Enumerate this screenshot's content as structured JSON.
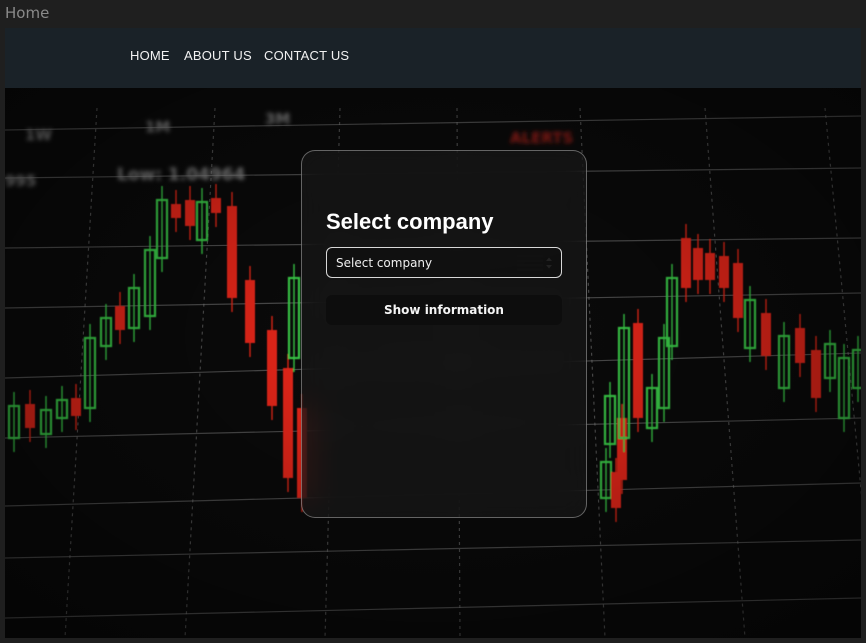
{
  "browser": {
    "tab_title": "Home"
  },
  "nav": {
    "items": [
      {
        "label": "HOME"
      },
      {
        "label": "ABOUT US"
      },
      {
        "label": "CONTACT US"
      }
    ]
  },
  "hero": {
    "background": "candlestick chart photo",
    "screen_labels": [
      "1W",
      "1M",
      "3M",
      "995",
      "Low: 1.04964",
      "ALERTS"
    ]
  },
  "card": {
    "title": "Select  company",
    "select": {
      "value": "Select company"
    },
    "button_label": "Show information"
  },
  "colors": {
    "navbar": "#1a2228",
    "bull": "#3fe04f",
    "bear": "#ff2a1a",
    "grid": "#9a9a9a"
  }
}
